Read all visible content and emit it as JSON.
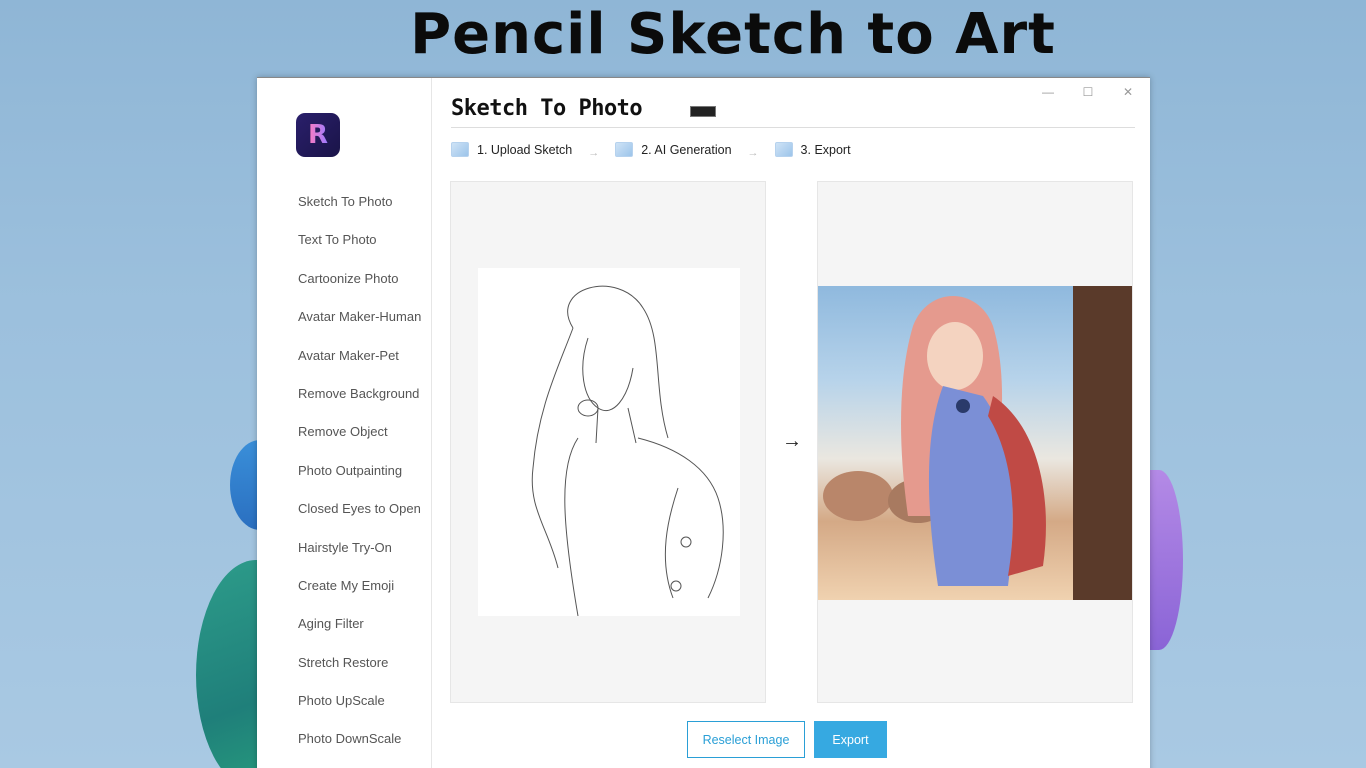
{
  "hero": {
    "title": "Pencil Sketch to Art"
  },
  "app": {
    "page_title": "Sketch To Photo",
    "window_controls": {
      "minimize": "—",
      "maximize": "☐",
      "close": "✕"
    }
  },
  "sidebar": {
    "items": [
      {
        "label": "Sketch To Photo"
      },
      {
        "label": "Text To Photo"
      },
      {
        "label": "Cartoonize Photo"
      },
      {
        "label": "Avatar Maker-Human"
      },
      {
        "label": "Avatar Maker-Pet"
      },
      {
        "label": "Remove Background"
      },
      {
        "label": "Remove Object"
      },
      {
        "label": "Photo Outpainting"
      },
      {
        "label": "Closed Eyes to Open"
      },
      {
        "label": "Hairstyle Try-On"
      },
      {
        "label": "Create My Emoji"
      },
      {
        "label": "Aging Filter"
      },
      {
        "label": "Stretch Restore"
      },
      {
        "label": "Photo UpScale"
      },
      {
        "label": "Photo DownScale"
      }
    ]
  },
  "steps": [
    {
      "label": "1. Upload Sketch",
      "icon": "upload-image-icon"
    },
    {
      "label": "2. AI Generation",
      "icon": "ai-search-icon"
    },
    {
      "label": "3. Export",
      "icon": "export-image-icon"
    }
  ],
  "step_separator": "→",
  "compare_arrow": "→",
  "buttons": {
    "reselect": "Reselect Image",
    "export": "Export"
  },
  "colors": {
    "accent": "#36a9e1",
    "logo_bg": "#1f1858",
    "logo_glyph": "#ff7cc0"
  },
  "logo": {
    "glyph": "R"
  }
}
